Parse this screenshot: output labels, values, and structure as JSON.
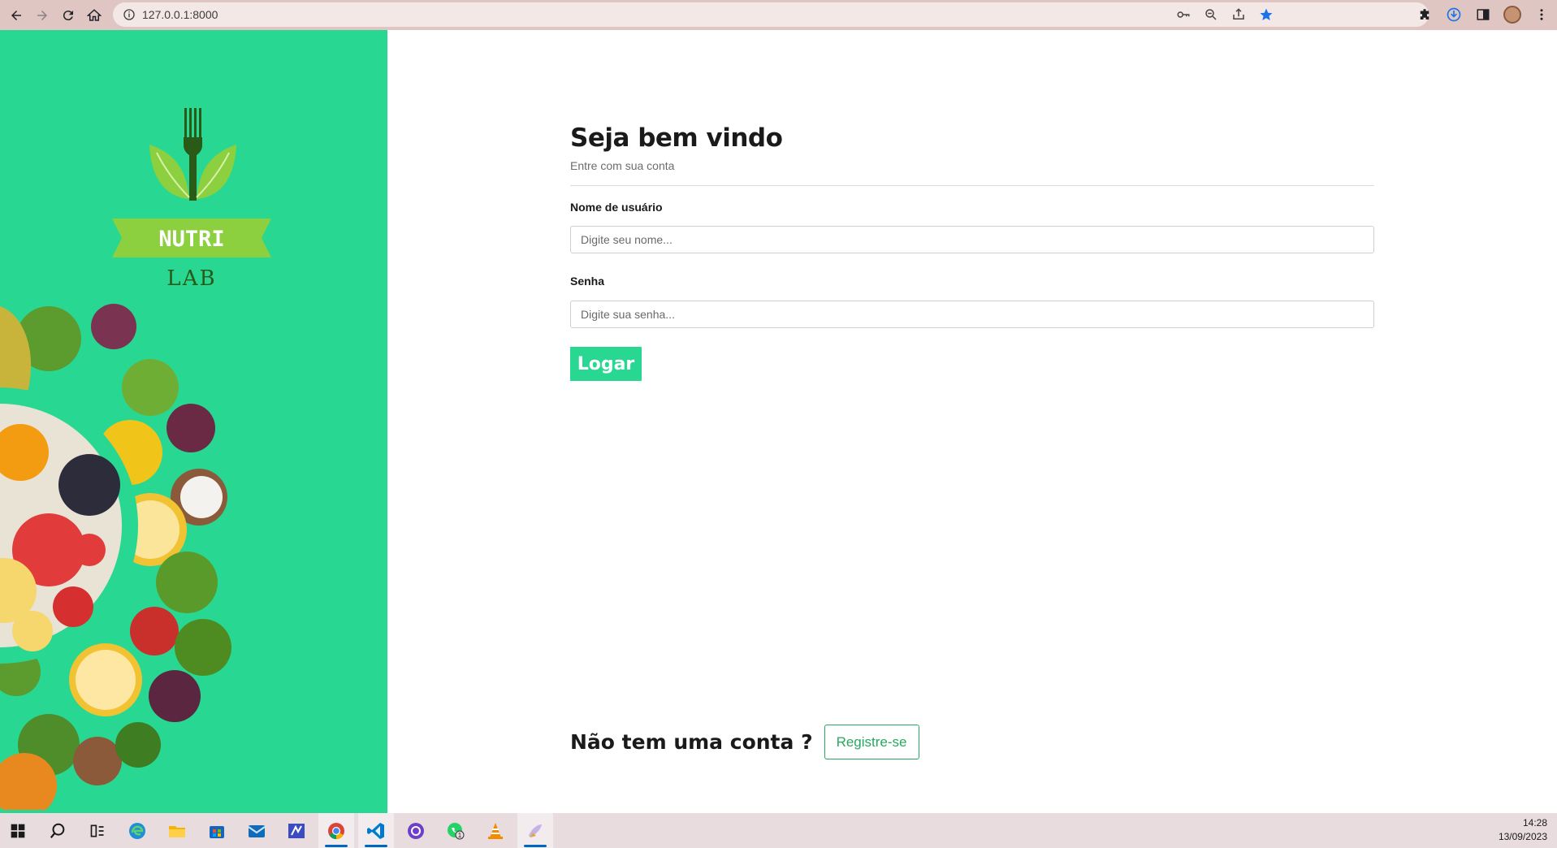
{
  "browser": {
    "url": "127.0.0.1:8000"
  },
  "brand": {
    "name_top": "NUTRI",
    "name_bottom": "LAB"
  },
  "login": {
    "title": "Seja bem vindo",
    "subtitle": "Entre com sua conta",
    "username_label": "Nome de usuário",
    "username_placeholder": "Digite seu nome...",
    "password_label": "Senha",
    "password_placeholder": "Digite sua senha...",
    "submit_label": "Logar"
  },
  "register": {
    "question": "Não tem uma conta ?",
    "button_label": "Registre-se"
  },
  "taskbar": {
    "whatsapp_badge": "1",
    "time": "14:28",
    "date": "13/09/2023"
  },
  "colors": {
    "accent": "#28d892",
    "register_green": "#28a85e"
  }
}
